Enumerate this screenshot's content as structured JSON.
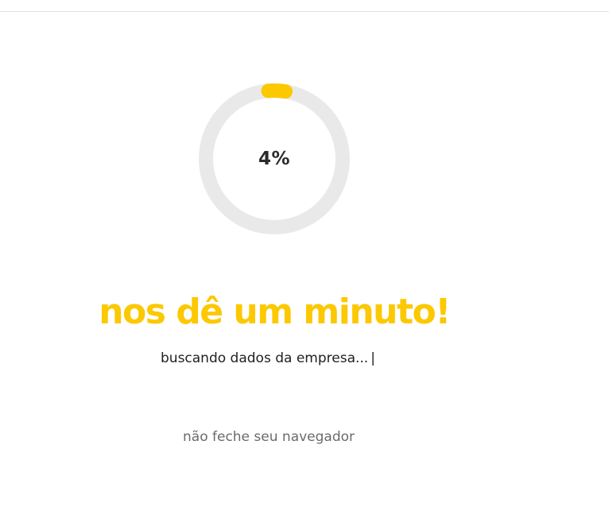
{
  "progress": {
    "percent_label": "4%",
    "fraction": 0.04,
    "track_color": "#e9e9e9",
    "fill_color": "#fcc800"
  },
  "headline": "nos dê um minuto!",
  "status": {
    "text": "buscando dados da empresa...",
    "caret": "|"
  },
  "warning": "não feche seu navegador",
  "colors": {
    "accent": "#fcc800",
    "text_dark": "#1f1f1f",
    "text_muted": "#6b6b6b"
  }
}
